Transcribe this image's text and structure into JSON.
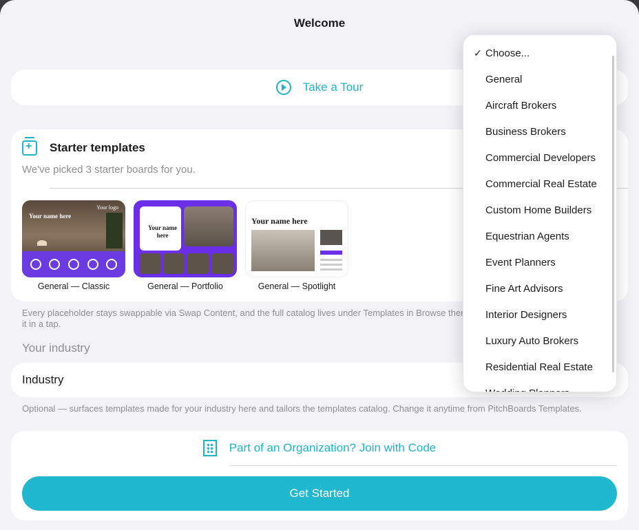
{
  "header": {
    "title": "Welcome"
  },
  "tour": {
    "label": "Take a Tour"
  },
  "starter": {
    "title": "Starter templates",
    "subtitle": "We've picked 3 starter boards for you.",
    "templates": [
      {
        "caption": "General — Classic",
        "thumb_title": "Your name here",
        "thumb_logo": "Your logo"
      },
      {
        "caption": "General — Portfolio",
        "thumb_title": "Your name here"
      },
      {
        "caption": "General — Spotlight",
        "thumb_title": "Your name here"
      }
    ]
  },
  "notes": {
    "swap": "Every placeholder stays swappable via Swap Content, and the full catalog lives under Templates in Browse there and add it in a tap.",
    "industry_help": "Optional — surfaces templates made for your industry here and tailors the templates catalog. Change it anytime from PitchBoards Templates."
  },
  "industry": {
    "section_label": "Your industry",
    "field_label": "Industry"
  },
  "org": {
    "join_label": "Part of an Organization? Join with Code",
    "get_started": "Get Started"
  },
  "dropdown": {
    "options": [
      "Choose...",
      "General",
      "Aircraft Brokers",
      "Business Brokers",
      "Commercial Developers",
      "Commercial Real Estate",
      "Custom Home Builders",
      "Equestrian Agents",
      "Event Planners",
      "Fine Art Advisors",
      "Interior Designers",
      "Luxury Auto Brokers",
      "Residential Real Estate",
      "Wedding Planners"
    ],
    "selected": "Choose..."
  },
  "colors": {
    "accent": "#1fb3c9",
    "button": "#1fb8cf",
    "purple": "#6a2fe6"
  }
}
